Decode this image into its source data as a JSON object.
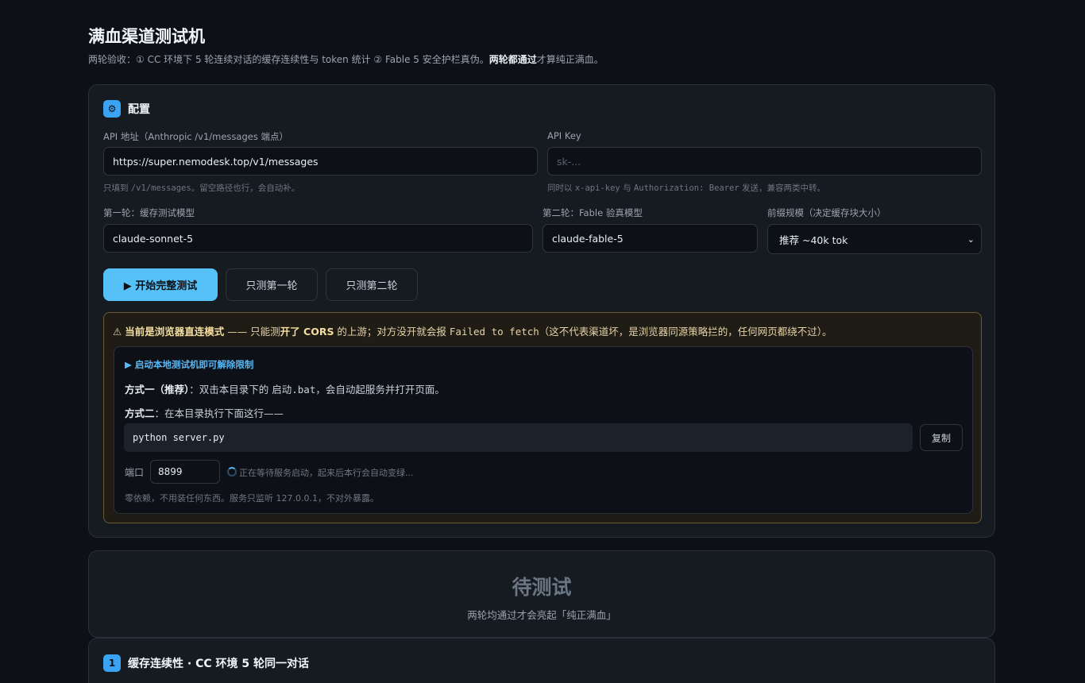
{
  "header": {
    "title": "满血渠道测试机",
    "subtitle_a": "两轮验收：① CC 环境下 5 轮连续对话的缓存连续性与 token 统计 ② Fable 5 安全护栏真伪。",
    "subtitle_bold": "两轮都通过",
    "subtitle_b": "才算纯正满血。"
  },
  "config": {
    "icon": "gear-icon",
    "title": "配置",
    "api_url_label": "API 地址（Anthropic /v1/messages 端点）",
    "api_url_value": "https://super.nemodesk.top/v1/messages",
    "api_url_hint_a": "只填到 ",
    "api_url_hint_code": "/v1/messages",
    "api_url_hint_b": "。留空路径也行，会自动补。",
    "api_key_label": "API Key",
    "api_key_placeholder": "sk-...",
    "api_key_hint_a": "同时以 ",
    "api_key_hint_code1": "x-api-key",
    "api_key_hint_mid": " 与 ",
    "api_key_hint_code2": "Authorization: Bearer",
    "api_key_hint_b": " 发送，兼容两类中转。",
    "round1_label": "第一轮：缓存测试模型",
    "round1_value": "claude-sonnet-5",
    "round2_label": "第二轮：Fable 验真模型",
    "round2_value": "claude-fable-5",
    "prefix_label": "前缀规模（决定缓存块大小）",
    "prefix_value": "推荐 ~40k tok"
  },
  "actions": {
    "start_full": "▶ 开始完整测试",
    "round1_only": "只测第一轮",
    "round2_only": "只测第二轮"
  },
  "warning": {
    "icon": "⚠",
    "bold_a": "当前是浏览器直连模式",
    "text_a": " —— 只能测",
    "bold_b": "开了 CORS",
    "text_b": " 的上游；对方没开就会报 ",
    "code": "Failed to fetch",
    "text_c": "（这不代表渠道坏，是浏览器同源策略拦的，任何网页都绕不过）。"
  },
  "local": {
    "toggle": "▶ 启动本地测试机即可解除限制",
    "method1_bold": "方式一（推荐）",
    "method1_text_a": "：双击本目录下的 ",
    "method1_code": "启动.bat",
    "method1_text_b": "，会自动起服务并打开页面。",
    "method2_bold": "方式二",
    "method2_text": "：在本目录执行下面这行——",
    "command": "python server.py",
    "copy": "复制",
    "port_label": "端口",
    "port_value": "8899",
    "waiting": "正在等待服务启动，起来后本行会自动变绿...",
    "footnote": "零依赖，不用装任何东西。服务只监听 127.0.0.1，不对外暴露。"
  },
  "status": {
    "title": "待测试",
    "subtitle": "两轮均通过才会亮起「纯正满血」"
  },
  "round1": {
    "badge": "1",
    "title": "缓存连续性 · CC 环境 5 轮同一对话"
  },
  "colors": {
    "background": "#0d1117",
    "card": "#161b22",
    "accent": "#56c1f6",
    "warning_border": "#6b5a2c"
  }
}
